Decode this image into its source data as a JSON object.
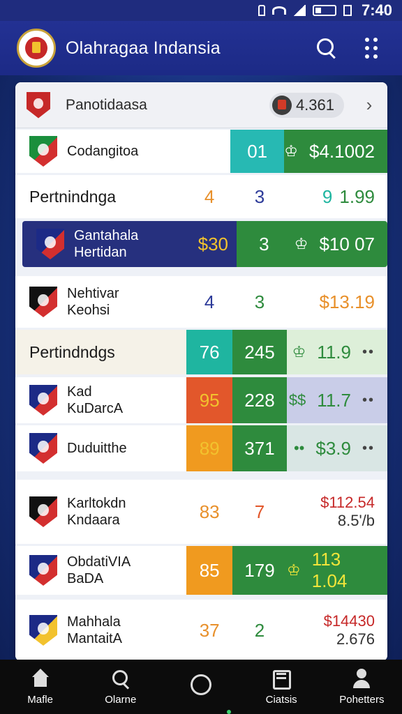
{
  "status_bar": {
    "time": "7:40"
  },
  "app_bar": {
    "title": "Olahragaa Indansia"
  },
  "top_row": {
    "label": "Panotidaasa",
    "chip_value": "4.361",
    "crest_color": "#c62828"
  },
  "rows": [
    {
      "team": "Codangitoa",
      "num1": "",
      "num2": "01",
      "price": "$4.1002",
      "bg": "#ffffff",
      "team_color": "#1a1a1a",
      "logo_primary": "#1a8f3c",
      "logo_secondary": "#d32f2f",
      "num1_bg": "transparent",
      "num1_color": "#1a1a1a",
      "num2_bg": "#27b9b3",
      "num2_color": "#ffffff",
      "price_bg": "#2e8b3d",
      "price_color": "#ffffff",
      "price_icon": "♔",
      "price_dots": ""
    },
    {
      "team": "Pertnindnga",
      "num1": "4",
      "num2": "3",
      "price": "1.99",
      "price_prefix": "9",
      "bg": "#ffffff",
      "team_color": "#1a1a1a",
      "logo_primary": "",
      "logo_secondary": "",
      "num1_bg": "transparent",
      "num1_color": "#e8902b",
      "num2_bg": "transparent",
      "num2_color": "#2c3a99",
      "price_bg": "transparent",
      "price_color": "#2e8b3d",
      "price_icon": "",
      "price_dots": ""
    },
    {
      "team": "Gantahala\nHertidan",
      "num1": "$30",
      "num2": "3",
      "price": "$10 07",
      "bg": "#26307e",
      "team_color": "#ffffff",
      "logo_primary": "#1c2a86",
      "logo_secondary": "#d32f2f",
      "num1_bg": "#26307e",
      "num1_color": "#f2c22e",
      "num2_bg": "#2e8b3d",
      "num2_color": "#ffffff",
      "price_bg": "#2e8b3d",
      "price_color": "#ffffff",
      "price_icon": "♔",
      "price_dots": ""
    },
    {
      "team": "Nehtivar\nKeohsi",
      "num1": "4",
      "num2": "3",
      "price": "$13.19",
      "bg": "#ffffff",
      "team_color": "#1a1a1a",
      "logo_primary": "#111111",
      "logo_secondary": "#d32f2f",
      "num1_bg": "transparent",
      "num1_color": "#2c3a99",
      "num2_bg": "transparent",
      "num2_color": "#2e8b3d",
      "price_bg": "transparent",
      "price_color": "#e8902b",
      "price_icon": "",
      "price_dots": ""
    },
    {
      "team": "Pertindndgs",
      "num1": "76",
      "num2": "245",
      "price": "11.9",
      "bg": "#f5f2e8",
      "team_color": "#1a1a1a",
      "logo_primary": "",
      "logo_secondary": "",
      "num1_bg": "#1fb5a0",
      "num1_color": "#ffffff",
      "num2_bg": "#2e8b3d",
      "num2_color": "#ffffff",
      "price_bg": "#ddefd9",
      "price_color": "#2e8b3d",
      "price_icon": "♔",
      "price_dots": "••"
    },
    {
      "team": "Kad\nKuDarcA",
      "num1": "95",
      "num2": "228",
      "price": "11.7",
      "bg": "#ffffff",
      "team_color": "#1a1a1a",
      "logo_primary": "#1c2a86",
      "logo_secondary": "#d32f2f",
      "num1_bg": "#e2572b",
      "num1_color": "#f2c22e",
      "num2_bg": "#2e8b3d",
      "num2_color": "#ffffff",
      "price_bg": "#c9cde8",
      "price_color": "#2e8b3d",
      "price_icon": "$$",
      "price_dots": "••"
    },
    {
      "team": "Duduitthe",
      "num1": "89",
      "num2": "371",
      "price": "$3.9",
      "bg": "#ffffff",
      "team_color": "#1a1a1a",
      "logo_primary": "#1c2a86",
      "logo_secondary": "#d32f2f",
      "num1_bg": "#f09a1f",
      "num1_color": "#f2c22e",
      "num2_bg": "#2e8b3d",
      "num2_color": "#ffffff",
      "price_bg": "#d9e6e4",
      "price_color": "#2e8b3d",
      "price_icon": "••",
      "price_dots": "••"
    },
    {
      "team": "Karltokdn\nKndaara",
      "num1": "83",
      "num2": "7",
      "price": "$112.54",
      "price_sub": "8.5'/b",
      "bg": "#ffffff",
      "team_color": "#1a1a1a",
      "logo_primary": "#111111",
      "logo_secondary": "#d32f2f",
      "num1_bg": "transparent",
      "num1_color": "#e8902b",
      "num2_bg": "transparent",
      "num2_color": "#e2572b",
      "price_bg": "transparent",
      "price_color": "#c62828",
      "price_icon": "",
      "price_dots": ""
    },
    {
      "team": "ObdatiVIA\nBaDA",
      "num1": "85",
      "num2": "179",
      "price": "113 1.04",
      "bg": "#ffffff",
      "team_color": "#1a1a1a",
      "logo_primary": "#1c2a86",
      "logo_secondary": "#d32f2f",
      "num1_bg": "#f09a1f",
      "num1_color": "#ffffff",
      "num2_bg": "#2e8b3d",
      "num2_color": "#ffffff",
      "price_bg": "#2e8b3d",
      "price_color": "#f2e53a",
      "price_icon": "♔",
      "price_dots": ""
    },
    {
      "team": "Mahhala\nMantaitA",
      "num1": "37",
      "num2": "2",
      "price": "$14430",
      "price_sub": "2.676",
      "bg": "#ffffff",
      "team_color": "#1a1a1a",
      "logo_primary": "#1c2a86",
      "logo_secondary": "#f2c22e",
      "num1_bg": "transparent",
      "num1_color": "#e8902b",
      "num2_bg": "transparent",
      "num2_color": "#2e8b3d",
      "price_bg": "transparent",
      "price_color": "#c62828",
      "price_icon": "",
      "price_dots": ""
    }
  ],
  "bottom_nav": [
    {
      "label": "Mafle",
      "icon": "home-icon"
    },
    {
      "label": "Olarne",
      "icon": "search-icon"
    },
    {
      "label": "",
      "icon": "circle-icon"
    },
    {
      "label": "Ciatsis",
      "icon": "list-icon"
    },
    {
      "label": "Pohetters",
      "icon": "person-icon"
    }
  ]
}
